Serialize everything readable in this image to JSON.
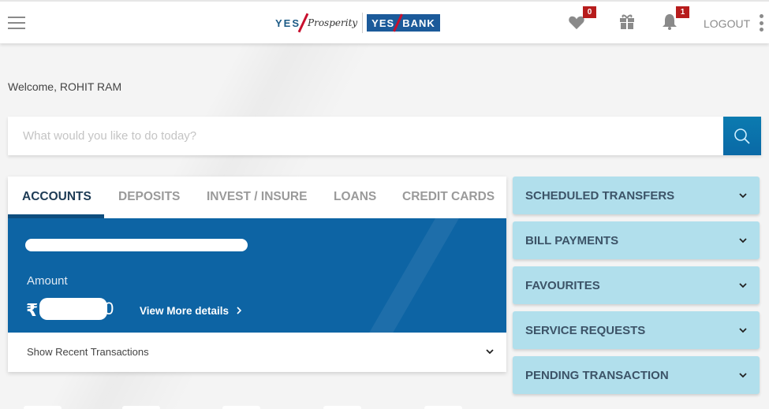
{
  "header": {
    "logo": {
      "yes_text": "YES",
      "prosperity_text": "Prosperity",
      "bank_yes": "YES",
      "bank_text": "BANK"
    },
    "favourites_badge": "0",
    "notifications_badge": "1",
    "logout_label": "LOGOUT",
    "icons": [
      "menu-icon",
      "heart-icon",
      "gift-icon",
      "bell-icon",
      "more-vertical-icon"
    ]
  },
  "welcome_text": "Welcome, ROHIT RAM",
  "search": {
    "placeholder": "What would you like to do today?",
    "value": ""
  },
  "tabs": [
    {
      "label": "ACCOUNTS",
      "active": true
    },
    {
      "label": "DEPOSITS",
      "active": false
    },
    {
      "label": "INVEST / INSURE",
      "active": false
    },
    {
      "label": "LOANS",
      "active": false
    },
    {
      "label": "CREDIT CARDS",
      "active": false
    }
  ],
  "account_card": {
    "account_name": "[redacted]",
    "amount_label": "Amount",
    "currency_symbol": "₹",
    "amount_visible_tail": "0",
    "view_more_label": "View More details",
    "colors": {
      "card_bg": "#0d64a4"
    }
  },
  "recent_transactions_label": "Show Recent Transactions",
  "accordion": [
    {
      "label": "SCHEDULED TRANSFERS"
    },
    {
      "label": "BILL PAYMENTS"
    },
    {
      "label": "FAVOURITES"
    },
    {
      "label": "SERVICE REQUESTS"
    },
    {
      "label": "PENDING TRANSACTION"
    }
  ],
  "colors": {
    "accent": "#0a69a6",
    "badge": "#b71c1c",
    "accordion_bg": "#b1dfec",
    "active_tab": "#1d3b55"
  }
}
